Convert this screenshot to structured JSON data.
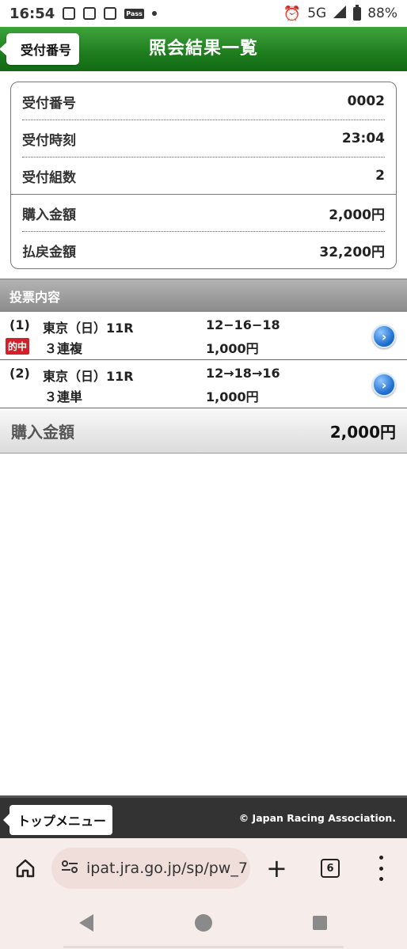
{
  "status_bar": {
    "time": "16:54",
    "pass_label": "Pass",
    "network": "5G",
    "battery": "88%"
  },
  "header": {
    "back_label": "受付番号",
    "title": "照会結果一覧"
  },
  "summary": {
    "rows": [
      {
        "label": "受付番号",
        "value": "0002"
      },
      {
        "label": "受付時刻",
        "value": "23:04"
      },
      {
        "label": "受付組数",
        "value": "2"
      },
      {
        "label": "購入金額",
        "value": "2,000円"
      },
      {
        "label": "払戻金額",
        "value": "32,200円"
      }
    ]
  },
  "section": {
    "title": "投票内容"
  },
  "bets": [
    {
      "num": "(1)",
      "venue": "東京（日）11R",
      "type": "３連複",
      "combo": "12−16−18",
      "amount": "1,000円",
      "hit_label": "的中"
    },
    {
      "num": "(2)",
      "venue": "東京（日）11R",
      "type": "３連単",
      "combo": "12→18→16",
      "amount": "1,000円"
    }
  ],
  "total": {
    "label": "購入金額",
    "value": "2,000円"
  },
  "footer": {
    "top_menu_label": "トップメニュー",
    "copyright": "© Japan Racing Association."
  },
  "browser": {
    "url": "ipat.jra.go.jp/sp/pw_7",
    "tab_count": "6"
  },
  "colors": {
    "header_green": "#1e7d1e",
    "hit_red": "#d0222a",
    "arrow_blue": "#1f6fd0"
  }
}
